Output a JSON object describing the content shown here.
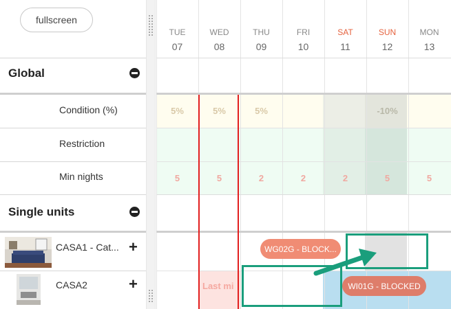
{
  "toolbar": {
    "fullscreen_label": "fullscreen"
  },
  "sections": {
    "global": {
      "title": "Global",
      "rows": [
        "Condition (%)",
        "Restriction",
        "Min nights"
      ]
    },
    "single_units": {
      "title": "Single units",
      "units": [
        {
          "name": "CASA1 - Cat..."
        },
        {
          "name": "CASA2"
        }
      ]
    }
  },
  "calendar": {
    "days": [
      {
        "dow": "TUE",
        "num": "07",
        "weekend": false
      },
      {
        "dow": "WED",
        "num": "08",
        "weekend": false
      },
      {
        "dow": "THU",
        "num": "09",
        "weekend": false
      },
      {
        "dow": "FRI",
        "num": "10",
        "weekend": false
      },
      {
        "dow": "SAT",
        "num": "11",
        "weekend": true
      },
      {
        "dow": "SUN",
        "num": "12",
        "weekend": true
      },
      {
        "dow": "MON",
        "num": "13",
        "weekend": false
      }
    ],
    "condition": [
      "5%",
      "5%",
      "5%",
      "",
      "",
      "-10%",
      ""
    ],
    "min_nights": [
      "5",
      "5",
      "2",
      "2",
      "2",
      "5",
      "5"
    ],
    "bookings": {
      "casa1": "WG02G - BLOCK...",
      "casa2_partial": "Last mi",
      "casa2": "WI01G - BLOCKED"
    }
  },
  "colors": {
    "weekend_text": "#e5623e",
    "booking_pill": "#f08c74",
    "booking_pill_dark": "#de7d6a",
    "highlight_box": "#1a9e7c",
    "arrow": "#1a9e7c"
  }
}
